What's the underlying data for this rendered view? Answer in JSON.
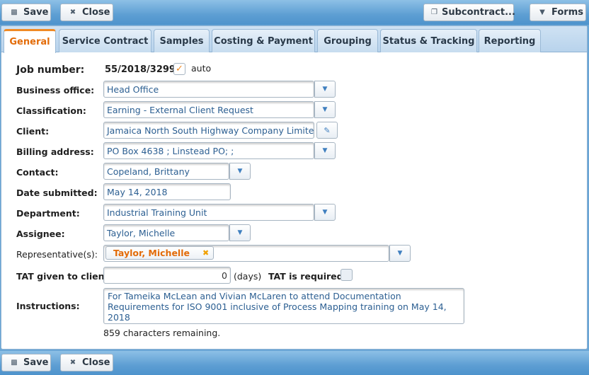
{
  "toolbar_top": {
    "save_label": "Save",
    "close_label": "Close",
    "subcontract_label": "Subcontract...",
    "forms_label": "Forms"
  },
  "toolbar_bottom": {
    "save_label": "Save",
    "close_label": "Close"
  },
  "tabs": [
    {
      "label": "General",
      "active": true
    },
    {
      "label": "Service Contract"
    },
    {
      "label": "Samples"
    },
    {
      "label": "Costing & Payment"
    },
    {
      "label": "Grouping"
    },
    {
      "label": "Status & Tracking"
    },
    {
      "label": "Reporting"
    }
  ],
  "form": {
    "job_number_label": "Job number:",
    "job_number_value": "55/2018/3299",
    "auto_label": "auto",
    "auto_checked": true,
    "business_office_label": "Business office:",
    "business_office_value": "Head Office",
    "classification_label": "Classification:",
    "classification_value": "Earning - External Client Request",
    "client_label": "Client:",
    "client_value": "Jamaica North South Highway Company Limited",
    "billing_address_label": "Billing address:",
    "billing_address_value": "PO Box 4638 ; Linstead PO;  ;",
    "contact_label": "Contact:",
    "contact_value": "Copeland, Brittany",
    "date_submitted_label": "Date submitted:",
    "date_submitted_value": "May 14, 2018",
    "department_label": "Department:",
    "department_value": "Industrial Training Unit",
    "assignee_label": "Assignee:",
    "assignee_value": "Taylor, Michelle",
    "representatives_label": "Representative(s):",
    "representatives": [
      "Taylor, Michelle"
    ],
    "tat_label": "TAT given to client:",
    "tat_value": "0",
    "tat_unit": "(days)",
    "tat_required_label": "TAT is required:",
    "tat_required_checked": false,
    "instructions_label": "Instructions:",
    "instructions_value": "For Tameika McLean and Vivian McLaren to attend Documentation Requirements for ISO 9001 inclusive of Process Mapping training on May 14, 2018",
    "chars_remaining": "859 characters remaining."
  },
  "icons": {
    "save": "floppy-disk-icon",
    "close": "close-x-icon",
    "subcontract": "copy-pages-icon",
    "forms": "chevron-down-icon",
    "dropdown": "chevron-down-icon",
    "edit": "pencil-icon",
    "check": "checkmark-icon"
  },
  "colors": {
    "accent": "#f08a24",
    "active_tab_text": "#e36c09",
    "field_text": "#2c5f92",
    "toolbar": "#5d9ed3"
  }
}
